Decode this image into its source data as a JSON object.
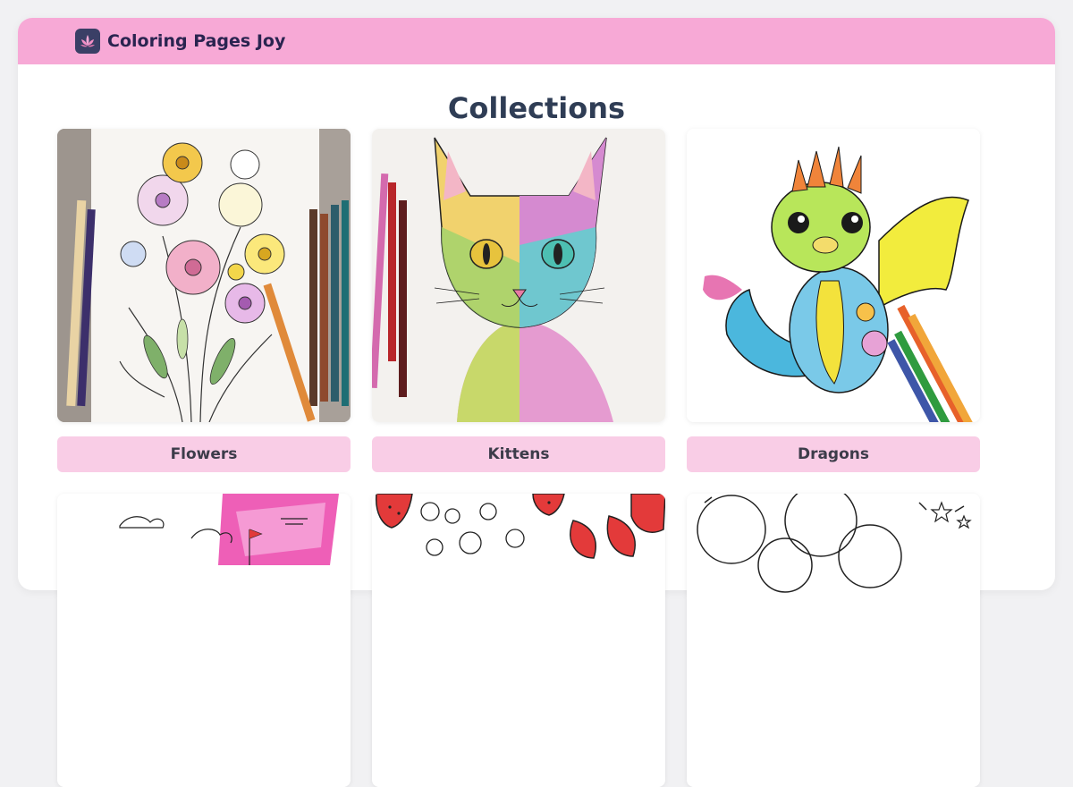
{
  "site": {
    "title": "Coloring Pages Joy",
    "logo_icon": "lotus-icon"
  },
  "page": {
    "heading": "Collections"
  },
  "collections": [
    {
      "label": "Flowers",
      "image": "flowers-illustration"
    },
    {
      "label": "Kittens",
      "image": "kitten-illustration"
    },
    {
      "label": "Dragons",
      "image": "dragon-illustration"
    },
    {
      "label": "",
      "image": "landscape-illustration"
    },
    {
      "label": "",
      "image": "strawberries-illustration"
    },
    {
      "label": "",
      "image": "balloons-illustration"
    }
  ],
  "colors": {
    "header": "#f7a9d6",
    "button": "#f9cde6",
    "title": "#2f3d55",
    "brand": "#2a2450"
  }
}
